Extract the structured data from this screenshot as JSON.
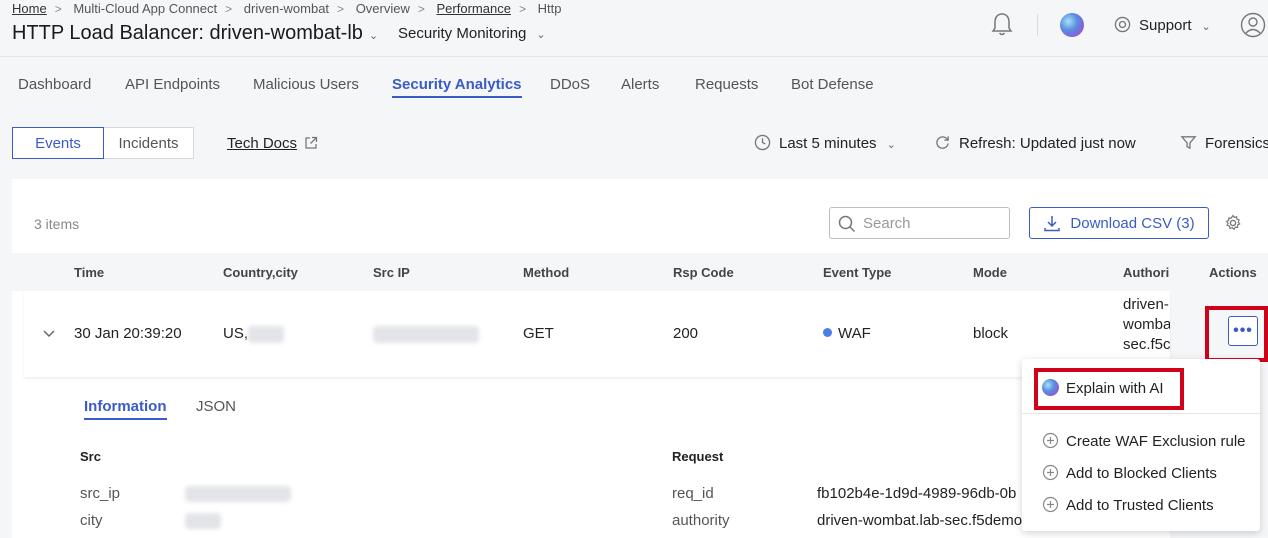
{
  "breadcrumb": {
    "items": [
      "Home",
      "Multi-Cloud App Connect",
      "driven-wombat",
      "Overview",
      "Performance",
      "Http"
    ],
    "separator": ">"
  },
  "header": {
    "title": "HTTP Load Balancer: driven-wombat-lb",
    "view_selector": "Security Monitoring",
    "support_label": "Support"
  },
  "tabs": [
    "Dashboard",
    "API Endpoints",
    "Malicious Users",
    "Security Analytics",
    "DDoS",
    "Alerts",
    "Requests",
    "Bot Defense"
  ],
  "active_tab": "Security Analytics",
  "toolbar": {
    "events_label": "Events",
    "incidents_label": "Incidents",
    "tech_docs_label": "Tech Docs",
    "time_range": "Last 5 minutes",
    "refresh_label": "Refresh: Updated just now",
    "forensics_label": "Forensics"
  },
  "table": {
    "item_count": "3 items",
    "search_placeholder": "Search",
    "download_label": "Download CSV (3)",
    "columns": [
      "Time",
      "Country,city",
      "Src IP",
      "Method",
      "Rsp Code",
      "Event Type",
      "Mode",
      "Authori",
      "Actions"
    ],
    "row": {
      "time": "30 Jan 20:39:20",
      "country": "US,",
      "method": "GET",
      "rsp_code": "200",
      "event_type": "WAF",
      "mode": "block",
      "authority_lines": [
        "driven-",
        "womba",
        "sec.f5c"
      ]
    }
  },
  "detail": {
    "tabs": [
      "Information",
      "JSON"
    ],
    "src_heading": "Src",
    "request_heading": "Request",
    "src_fields": [
      {
        "key": "src_ip"
      },
      {
        "key": "city"
      }
    ],
    "request_fields": [
      {
        "key": "req_id",
        "value": "fb102b4e-1d9d-4989-96db-0b"
      },
      {
        "key": "authority",
        "value": "driven-wombat.lab-sec.f5demo"
      }
    ]
  },
  "action_menu": {
    "items": [
      "Explain with AI",
      "Create WAF Exclusion rule",
      "Add to Blocked Clients",
      "Add to Trusted Clients"
    ]
  },
  "colors": {
    "accent": "#3a5bc8",
    "highlight": "#d0021b",
    "waf_dot": "#4a7fe8"
  }
}
